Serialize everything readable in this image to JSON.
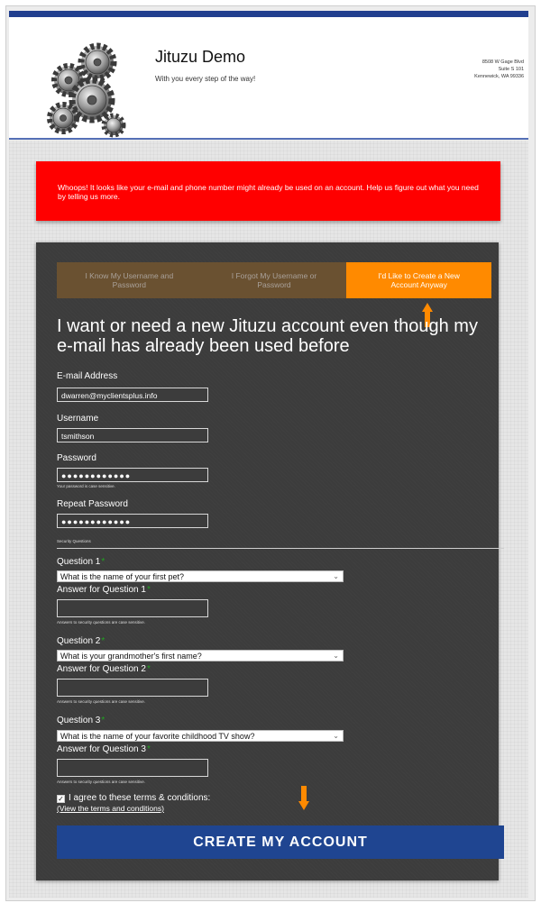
{
  "header": {
    "title": "Jituzu Demo",
    "tagline": "With you every step of the way!",
    "address": [
      "8508 W Gage Blvd",
      "Suite S 101",
      "Kennewick, WA 99336"
    ]
  },
  "alert": {
    "message": "Whoops! It looks like your e-mail and phone number might already be used on an account. Help us figure out what you need by telling us more."
  },
  "tabs": [
    {
      "label": "I Know My Username and Password",
      "active": false
    },
    {
      "label": "I Forgot My Username or Password",
      "active": false
    },
    {
      "label": "I'd Like to Create a New Account Anyway",
      "active": true
    }
  ],
  "form": {
    "headline": "I want or need a new Jituzu account even though my e-mail has already been used before",
    "email": {
      "label": "E-mail Address",
      "value": "dwarren@myclientsplus.info"
    },
    "username": {
      "label": "Username",
      "value": "tsmithson"
    },
    "password": {
      "label": "Password",
      "value": "●●●●●●●●●●●●",
      "note": "Your password is case sensitive."
    },
    "repeat_password": {
      "label": "Repeat Password",
      "value": "●●●●●●●●●●●●"
    },
    "security_heading": "Security Questions",
    "required_mark": "*",
    "questions": [
      {
        "label": "Question 1",
        "selected": "What is the name of your first pet?",
        "answer_label": "Answer for Question 1",
        "answer_value": "",
        "note": "Answers to security questions are case sensitive."
      },
      {
        "label": "Question 2",
        "selected": "What is your grandmother's first name?",
        "answer_label": "Answer for Question 2",
        "answer_value": "",
        "note": "Answers to security questions are case sensitive."
      },
      {
        "label": "Question 3",
        "selected": "What is the name of your favorite childhood TV show?",
        "answer_label": "Answer for Question 3",
        "answer_value": "",
        "note": "Answers to security questions are case sensitive."
      }
    ],
    "agree_label": "I agree to these terms & conditions:",
    "agree_checked": true,
    "terms_link": "(View the terms and conditions)",
    "submit_label": "CREATE MY ACCOUNT"
  },
  "colors": {
    "accent": "#ff8a00",
    "brand_blue": "#1f4591",
    "alert_red": "#ff0000",
    "panel": "#3c3c3c",
    "inactive_tab": "#6a5131"
  },
  "icons": {
    "logo": "gears-logo",
    "annotation": "orange-arrow",
    "select": "chevron-down-icon",
    "checkbox": "checkmark-icon"
  }
}
